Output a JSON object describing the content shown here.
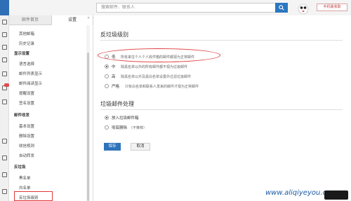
{
  "search": {
    "placeholder": "搜索邮件、联系人"
  },
  "header": {
    "tag": "手机版收取"
  },
  "tabs": [
    {
      "label": "邮件首页"
    },
    {
      "label": "设置"
    }
  ],
  "sidebar": {
    "items": [
      {
        "label": "其他邮箱",
        "kind": "item"
      },
      {
        "label": "历史记录",
        "kind": "item"
      },
      {
        "label": "显示设置",
        "kind": "head"
      },
      {
        "label": "语言选择",
        "kind": "item"
      },
      {
        "label": "邮件列表显示",
        "kind": "item"
      },
      {
        "label": "邮件阅读显示",
        "kind": "item"
      },
      {
        "label": "提醒设置",
        "kind": "item"
      },
      {
        "label": "签名设置",
        "kind": "item"
      },
      {
        "label": "邮件收发",
        "kind": "head"
      },
      {
        "label": "基本设置",
        "kind": "item"
      },
      {
        "label": "删除设置",
        "kind": "item"
      },
      {
        "label": "收信规则",
        "kind": "item"
      },
      {
        "label": "自动转发",
        "kind": "item"
      },
      {
        "label": "反垃圾",
        "kind": "head"
      },
      {
        "label": "黑名单",
        "kind": "item"
      },
      {
        "label": "白名单",
        "kind": "item"
      },
      {
        "label": "反垃圾级别",
        "kind": "item"
      }
    ]
  },
  "main": {
    "section1_title": "反垃圾级别",
    "levels": [
      {
        "label": "低",
        "desc": "所有来往个人个人收件箱的邮件都视为正常邮件",
        "selected": false
      },
      {
        "label": "中",
        "desc": "除黑名单以外的所有邮件都不视为垃圾邮件",
        "selected": true
      },
      {
        "label": "高",
        "desc": "除黑名单以外及黑白名单设置外过滤垃圾邮件",
        "selected": false
      },
      {
        "label": "严格",
        "desc": "只有白名单和联系人发来的邮件才视为正常邮件",
        "selected": false
      }
    ],
    "section2_title": "垃圾邮件处理",
    "handling": [
      {
        "label": "放入垃圾邮件箱",
        "selected": true
      },
      {
        "label": "彻底删除",
        "note": "（不推荐）",
        "selected": false
      }
    ],
    "save_label": "保存",
    "cancel_label": "取消"
  },
  "watermark": "www.aliqiyeyou.com",
  "colors": {
    "accent": "#2d73bb",
    "annotation": "#e03a3a"
  }
}
